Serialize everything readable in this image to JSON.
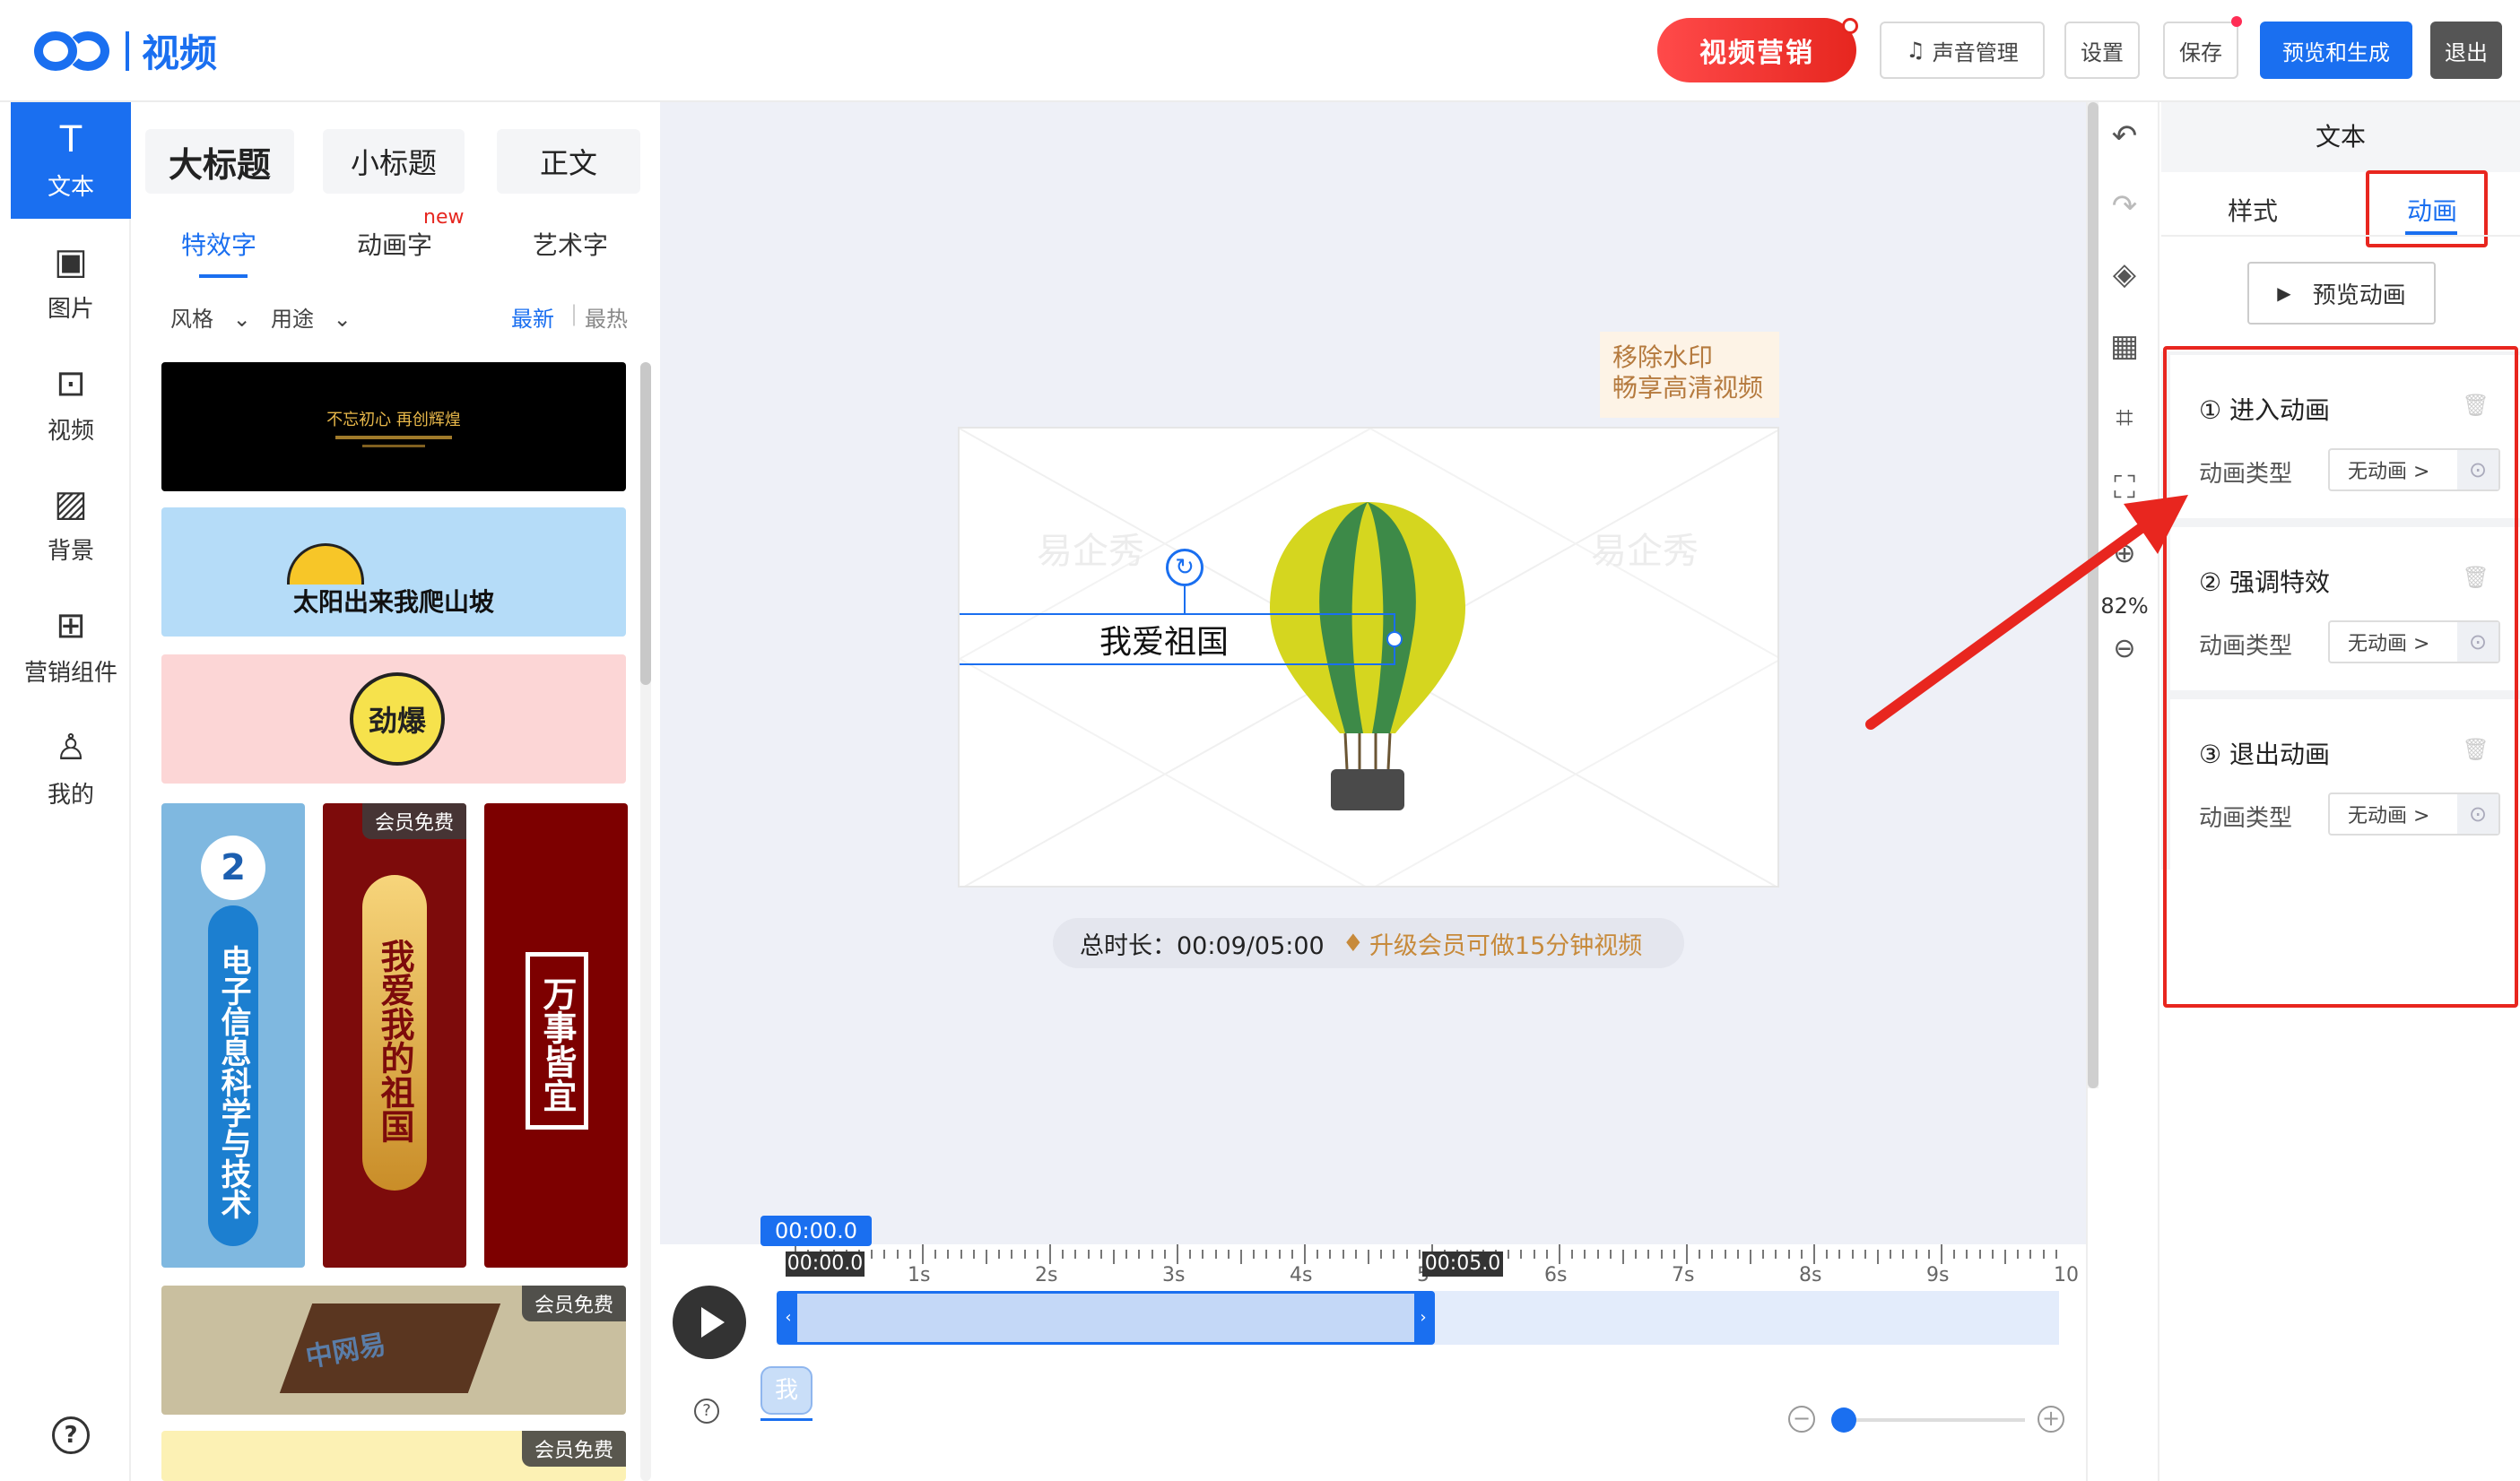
{
  "header": {
    "logo_text": "视频",
    "promo": "视频营销",
    "sound": "声音管理",
    "settings": "设置",
    "save": "保存",
    "preview_generate": "预览和生成",
    "exit": "退出"
  },
  "leftnav": {
    "items": [
      {
        "label": "文本",
        "icon": "text-icon"
      },
      {
        "label": "图片",
        "icon": "image-icon"
      },
      {
        "label": "视频",
        "icon": "video-icon"
      },
      {
        "label": "背景",
        "icon": "background-icon"
      },
      {
        "label": "营销组件",
        "icon": "components-icon"
      },
      {
        "label": "我的",
        "icon": "user-icon"
      }
    ],
    "help": "?"
  },
  "panel": {
    "size_tabs": [
      "大标题",
      "小标题",
      "正文"
    ],
    "sub_tabs": [
      "特效字",
      "动画字",
      "艺术字"
    ],
    "new_badge": "new",
    "filters": {
      "style": "风格",
      "use": "用途",
      "newest": "最新",
      "hottest": "最热"
    },
    "tiles": {
      "t1_line1": "不忘初心 再创辉煌",
      "t2": "太阳出来我爬山坡",
      "t3": "劲爆",
      "t4_num": "2",
      "t4_text": "电子信息科学与技术",
      "t5_text": "我爱我的祖国",
      "t6_text": "万事皆宜",
      "t8_text": "中网易",
      "member_free": "会员免费"
    }
  },
  "canvas": {
    "watermark_notice_1": "移除水印",
    "watermark_notice_2": "畅享高清视频",
    "watermark_left": "易企秀",
    "watermark_right": "易企秀",
    "text_element": "我爱祖国",
    "duration_label": "总时长：00:09/05:00",
    "upgrade": "升级会员可做15分钟视频"
  },
  "timeline": {
    "playhead": "00:00.0",
    "start_marker": "00:00.0",
    "end_marker": "00:05.0",
    "ticks": [
      "1s",
      "2s",
      "3s",
      "4s",
      "5",
      "6s",
      "7s",
      "8s",
      "9s",
      "10"
    ],
    "track_label": "我",
    "help": "?"
  },
  "toolstrip": {
    "zoom": "82%"
  },
  "rightpanel": {
    "title": "文本",
    "tabs": [
      "样式",
      "动画"
    ],
    "preview_btn": "预览动画",
    "blocks": [
      {
        "title": "① 进入动画",
        "label": "动画类型",
        "value": "无动画 >"
      },
      {
        "title": "② 强调特效",
        "label": "动画类型",
        "value": "无动画 >"
      },
      {
        "title": "③ 退出动画",
        "label": "动画类型",
        "value": "无动画 >"
      }
    ]
  },
  "colors": {
    "accent": "#1a6ff0",
    "highlight": "#e8261f"
  }
}
